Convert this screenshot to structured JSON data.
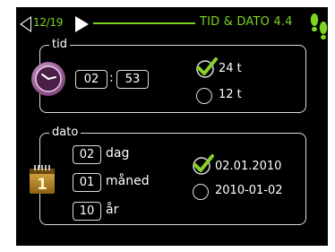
{
  "header": {
    "page_counter": "12/19",
    "title": "TID & DATO 4.4"
  },
  "time_section": {
    "legend": "tid",
    "hours": "02",
    "separator": ":",
    "minutes": "53",
    "options": [
      {
        "label": "24 t",
        "selected": true
      },
      {
        "label": "12 t",
        "selected": false
      }
    ]
  },
  "date_section": {
    "legend": "dato",
    "calendar_day": "1",
    "fields": [
      {
        "value": "02",
        "label": "dag"
      },
      {
        "value": "01",
        "label": "måned"
      },
      {
        "value": "10",
        "label": "år"
      }
    ],
    "options": [
      {
        "label": "02.01.2010",
        "selected": true
      },
      {
        "label": "2010-01-02",
        "selected": false
      }
    ]
  },
  "colors": {
    "accent": "#7ed321",
    "check": "#8cd02a",
    "clock": "#a96aa3",
    "calendar": "#b98a2a"
  },
  "icons": [
    "back-arrow-icon",
    "forward-arrow-icon",
    "footprint-icon",
    "clock-icon",
    "calendar-icon",
    "checkmark-icon"
  ]
}
